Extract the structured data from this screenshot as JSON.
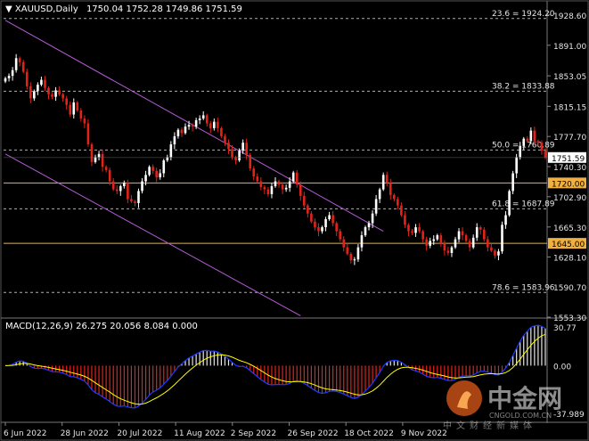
{
  "window": {
    "symbol_timeframe": "XAUUSD,Daily",
    "ohlc": "1750.04 1752.28 1749.86 1751.59"
  },
  "macd": {
    "label": "MACD(12,26,9) 26.275 20.056 8.084 0.000",
    "axis_ticks": [
      "30.77",
      "0.00",
      "-37.989"
    ]
  },
  "watermark": {
    "brand": "中金网",
    "sub": "中文财经新媒体",
    "url": "CNGOLD.COM.CN"
  },
  "colors": {
    "bull": "#ffffff",
    "bear": "#e2231a",
    "channel": "#b55bd6",
    "level": "#f0b040",
    "fib": "#cfcfcf",
    "macd_line": "#1e3cff",
    "signal_line": "#ffff00"
  },
  "chart_data": {
    "type": "candlestick",
    "x_labels": [
      "6 Jun 2022",
      "28 Jun 2022",
      "20 Jul 2022",
      "11 Aug 2022",
      "2 Sep 2022",
      "26 Sep 2022",
      "18 Oct 2022",
      "9 Nov 2022"
    ],
    "y_ticks": [
      1928.6,
      1891.0,
      1853.05,
      1815.15,
      1777.7,
      1740.3,
      1702.9,
      1665.3,
      1628.1,
      1590.7,
      1553.3
    ],
    "y_tick_labels": [
      "1928.60",
      "1891.00",
      "1853.05",
      "1815.15",
      "1777.70",
      "1740.30",
      "1702.90",
      "1665.30",
      "1628.10",
      "1590.70",
      "1553.30"
    ],
    "ylim": [
      1553.3,
      1945
    ],
    "current_price": "1751.59",
    "horizontal_levels": [
      {
        "price": 1720.0,
        "label": "1720.00"
      },
      {
        "price": 1645.0,
        "label": "1645.00"
      }
    ],
    "fibonacci_levels": [
      {
        "price": 1924.2,
        "label": "23.6 = 1924.20"
      },
      {
        "price": 1833.88,
        "label": "38.2 = 1833.88"
      },
      {
        "price": 1760.89,
        "label": "50.0 = 1760.89"
      },
      {
        "price": 1687.89,
        "label": "61.8 = 1687.89"
      },
      {
        "price": 1583.96,
        "label": "78.6 = 1583.96"
      }
    ],
    "channel_lines": [
      {
        "from": [
          0,
          1922
        ],
        "to": [
          105,
          1660
        ]
      },
      {
        "from": [
          0,
          1756
        ],
        "to": [
          82,
          1555
        ]
      }
    ],
    "closes": [
      1850,
      1853,
      1860,
      1875,
      1870,
      1858,
      1840,
      1825,
      1834,
      1842,
      1848,
      1838,
      1830,
      1827,
      1835,
      1830,
      1825,
      1817,
      1805,
      1820,
      1810,
      1800,
      1794,
      1768,
      1746,
      1752,
      1756,
      1740,
      1736,
      1722,
      1712,
      1710,
      1716,
      1720,
      1700,
      1697,
      1695,
      1710,
      1722,
      1730,
      1740,
      1735,
      1727,
      1732,
      1748,
      1752,
      1768,
      1778,
      1786,
      1782,
      1790,
      1792,
      1790,
      1798,
      1800,
      1804,
      1794,
      1788,
      1796,
      1788,
      1778,
      1770,
      1762,
      1752,
      1748,
      1760,
      1770,
      1755,
      1738,
      1728,
      1722,
      1715,
      1712,
      1706,
      1716,
      1722,
      1718,
      1712,
      1714,
      1722,
      1733,
      1718,
      1704,
      1692,
      1682,
      1672,
      1665,
      1660,
      1665,
      1675,
      1680,
      1670,
      1660,
      1650,
      1640,
      1632,
      1624,
      1625,
      1640,
      1655,
      1665,
      1670,
      1682,
      1700,
      1712,
      1730,
      1720,
      1705,
      1700,
      1692,
      1680,
      1668,
      1660,
      1658,
      1665,
      1660,
      1650,
      1642,
      1648,
      1650,
      1655,
      1645,
      1636,
      1633,
      1640,
      1650,
      1660,
      1655,
      1648,
      1640,
      1652,
      1665,
      1662,
      1650,
      1640,
      1636,
      1630,
      1635,
      1668,
      1680,
      1710,
      1732,
      1752,
      1766,
      1775,
      1772,
      1785,
      1772,
      1770,
      1760,
      1751.59
    ]
  }
}
